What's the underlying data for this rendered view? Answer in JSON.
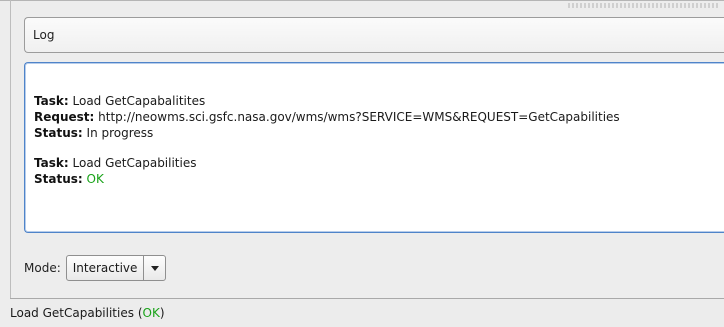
{
  "log_header": {
    "label": "Log"
  },
  "log": {
    "entries": [
      {
        "task_label": "Task:",
        "task_value": "Load GetCapabalitites",
        "request_label": "Request:",
        "request_value": "http://neowms.sci.gsfc.nasa.gov/wms/wms?SERVICE=WMS&REQUEST=GetCapabilities",
        "status_label": "Status:",
        "status_value": "In progress"
      },
      {
        "task_label": "Task:",
        "task_value": "Load GetCapabilities",
        "status_label": "Status:",
        "status_value": "OK"
      }
    ]
  },
  "mode": {
    "label": "Mode:",
    "selected": "Interactive"
  },
  "status_bar": {
    "text": "Load GetCapabilities",
    "open_paren": "(",
    "status": "OK",
    "close_paren": ")"
  },
  "colors": {
    "ok": "#1aa31a",
    "focus_border": "#4f84c9"
  }
}
